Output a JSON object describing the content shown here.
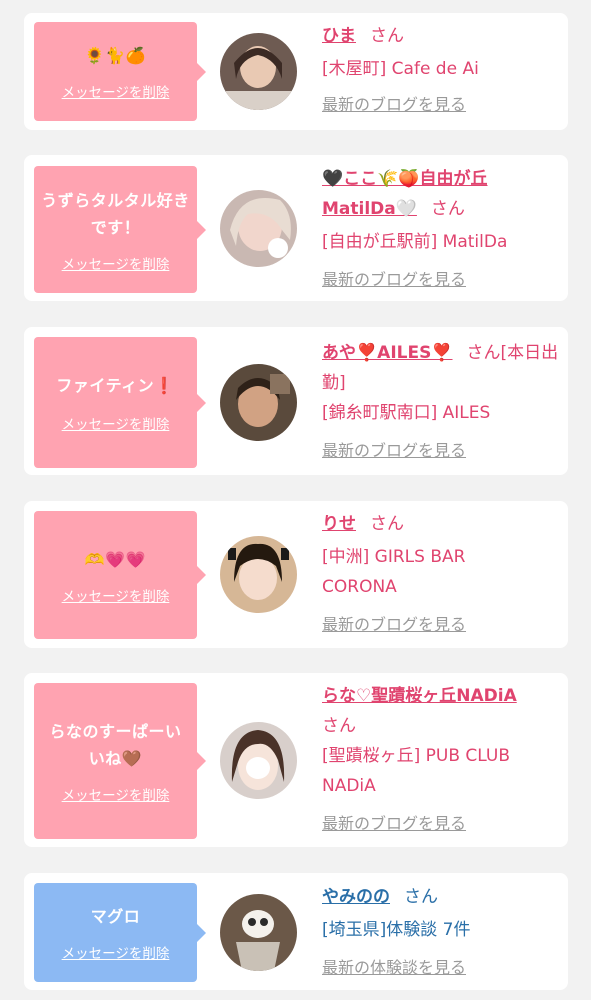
{
  "cards": [
    {
      "message": "🌻🐈🍊",
      "delete_label": "メッセージを削除",
      "name": "ひま",
      "honorific": "さん",
      "shop": "[木屋町] Cafe de Ai",
      "link": "最新のブログを見る",
      "color": "pink"
    },
    {
      "message": "うずらタルタル好きです！",
      "delete_label": "メッセージを削除",
      "name_line1": "🖤ここ🌾🍑自由が丘",
      "name_line2": "MatilDa🤍",
      "honorific": "さん",
      "shop": "[自由が丘駅前] MatilDa",
      "link": "最新のブログを見る",
      "color": "pink"
    },
    {
      "message": "ファイティン❗️",
      "delete_label": "メッセージを削除",
      "name": "あや❣️AILES❣️",
      "honorific": "さん",
      "status": "[本日出勤]",
      "shop": "[錦糸町駅南口] AILES",
      "link": "最新のブログを見る",
      "color": "pink"
    },
    {
      "message": "🫶💗💗",
      "delete_label": "メッセージを削除",
      "name": "りせ",
      "honorific": "さん",
      "shop_line1": "[中洲] GIRLS BAR",
      "shop_line2": "CORONA",
      "link": "最新のブログを見る",
      "color": "pink"
    },
    {
      "message": "らなのすーぱーいいね🤎",
      "delete_label": "メッセージを削除",
      "name": "らな♡聖蹟桜ヶ丘NADiA",
      "honorific": "さん",
      "shop_line1": "[聖蹟桜ヶ丘] PUB CLUB",
      "shop_line2": "NADiA",
      "link": "最新のブログを見る",
      "color": "pink"
    },
    {
      "message": "マグロ",
      "delete_label": "メッセージを削除",
      "name": "やみのの",
      "honorific": "さん",
      "shop": "[埼玉県]体験談 7件",
      "link": "最新の体験談を見る",
      "color": "blue"
    }
  ]
}
